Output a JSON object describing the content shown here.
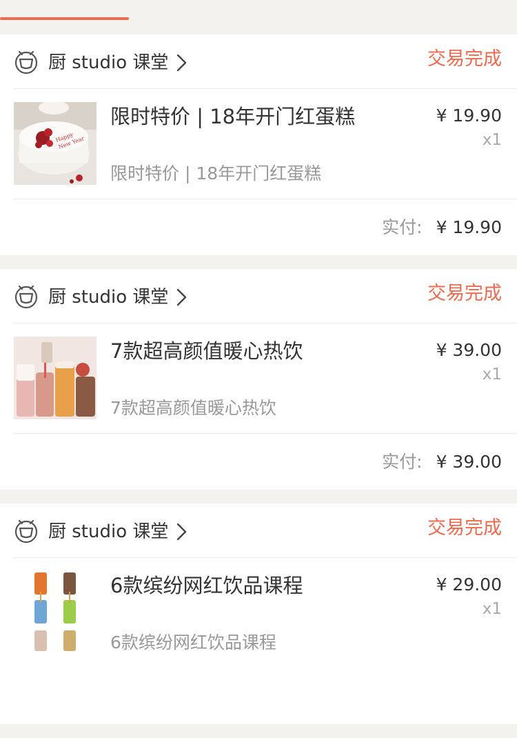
{
  "tabs": {
    "active_index": 0
  },
  "orders": [
    {
      "shop": "厨 studio 课堂",
      "status": "交易完成",
      "title": "限时特价 | 18年开门红蛋糕",
      "subtitle": "限时特价 | 18年开门红蛋糕",
      "price": "¥ 19.90",
      "qty": "x1",
      "paid_label": "实付:",
      "paid_amount": "¥ 19.90",
      "thumb_icon": "cake-image"
    },
    {
      "shop": "厨 studio 课堂",
      "status": "交易完成",
      "title": "7款超高颜值暖心热饮",
      "subtitle": "7款超高颜值暖心热饮",
      "price": "¥ 39.00",
      "qty": "x1",
      "paid_label": "实付:",
      "paid_amount": "¥ 39.00",
      "thumb_icon": "hot-drinks-image"
    },
    {
      "shop": "厨 studio 课堂",
      "status": "交易完成",
      "title": "6款缤纷网红饮品课程",
      "subtitle": "6款缤纷网红饮品课程",
      "price": "¥ 29.00",
      "qty": "x1",
      "paid_label": "",
      "paid_amount": "",
      "thumb_icon": "colorful-drinks-image"
    }
  ],
  "colors": {
    "accent": "#ef6a4e",
    "background": "#f3f2ee"
  }
}
